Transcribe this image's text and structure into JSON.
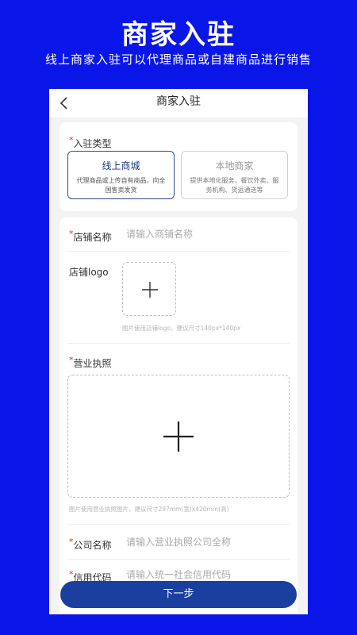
{
  "promo": {
    "title": "商家入驻",
    "subtitle": "线上商家入驻可以代理商品或自建商品进行销售"
  },
  "navbar": {
    "title": "商家入驻",
    "back_icon": "chevron-left-icon"
  },
  "settle_type": {
    "label": "入驻类型",
    "options": [
      {
        "title": "线上商城",
        "desc": "代理商品或上传自有商品，向全国售卖发货",
        "selected": true
      },
      {
        "title": "本地商家",
        "desc": "提供本地化服务，餐饮外卖、服务机构、货运通送等",
        "selected": false
      }
    ]
  },
  "form": {
    "shop_name": {
      "label": "店铺名称",
      "placeholder": "请输入商铺名称"
    },
    "shop_logo": {
      "label": "店铺logo",
      "hint": "图片使用店铺logo，建议尺寸140px*140px"
    },
    "license": {
      "label": "营业执照",
      "hint": "图片使用营业执照图片，建议尺寸297mm(宽)x420mm(高)"
    },
    "company_name": {
      "label": "公司名称",
      "placeholder": "请输入营业执照公司全称"
    },
    "credit_code": {
      "label": "信用代码",
      "placeholder": "请输入统一社会信用代码"
    }
  },
  "actions": {
    "next_label": "下一步"
  },
  "colors": {
    "background": "#0a16e8",
    "primary_button": "#1b3f9e",
    "required_mark": "#e03030",
    "selected_border": "#2c4a8a"
  }
}
